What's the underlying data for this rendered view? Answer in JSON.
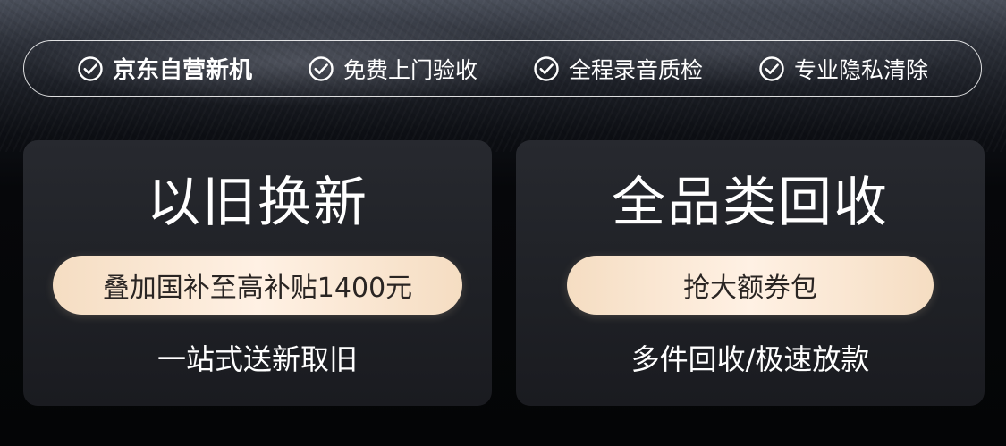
{
  "assurance": {
    "items": [
      {
        "label": "京东自营新机",
        "icon": "check-circle-icon",
        "emphasis": true
      },
      {
        "label": "免费上门验收",
        "icon": "check-circle-icon"
      },
      {
        "label": "全程录音质检",
        "icon": "check-circle-icon"
      },
      {
        "label": "专业隐私清除",
        "icon": "check-circle-icon"
      }
    ]
  },
  "cards": [
    {
      "title": "以旧换新",
      "button_label": "叠加国补至高补贴1400元",
      "subtitle": "一站式送新取旧"
    },
    {
      "title": "全品类回收",
      "button_label": "抢大额券包",
      "subtitle": "多件回收/极速放款"
    }
  ],
  "colors": {
    "pill_gradient_edge": "#f5ddc2",
    "pill_gradient_center": "#fff1e4",
    "pill_text": "#2a2523",
    "card_background": "#24262b",
    "text_primary": "#ffffff"
  }
}
